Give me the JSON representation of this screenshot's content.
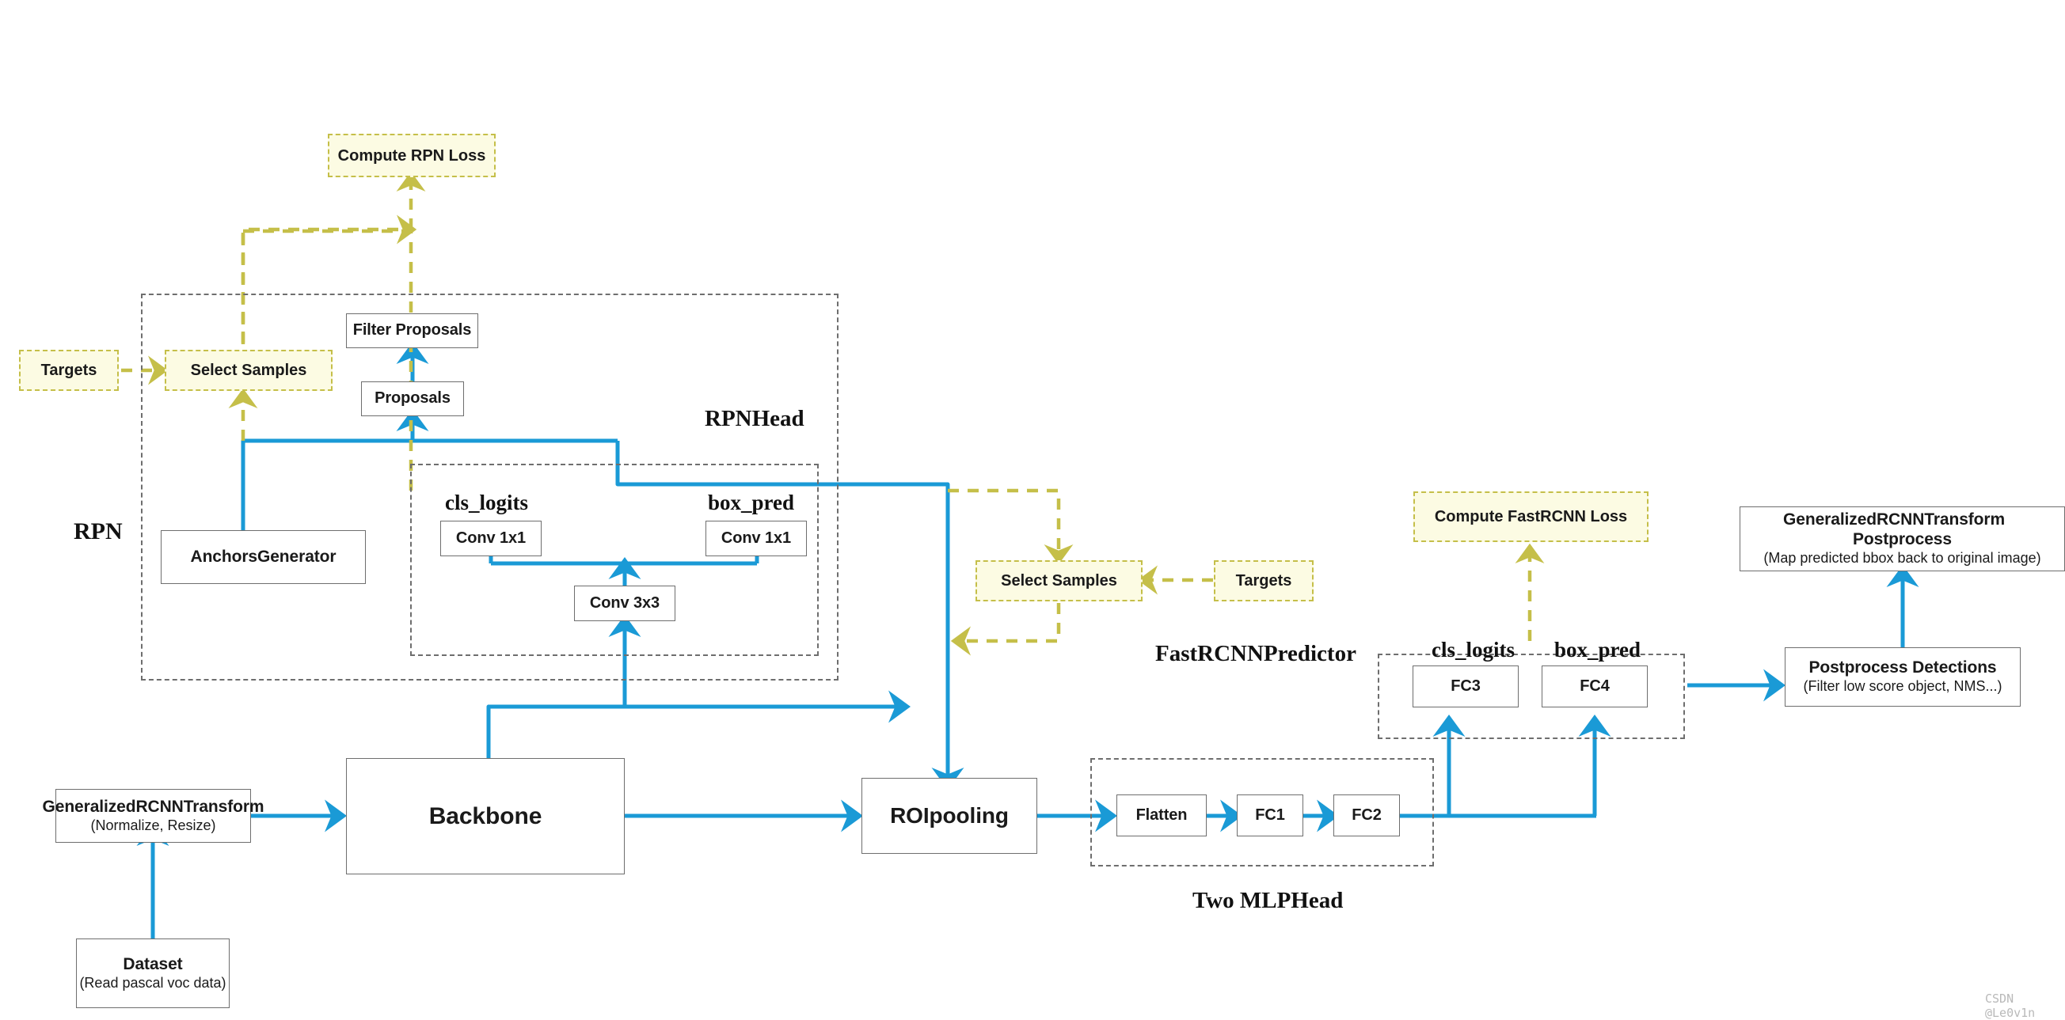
{
  "diagram": {
    "title": "Faster R-CNN training / inference pipeline",
    "colors": {
      "flow_blue": "#1a9ad6",
      "loss_yellow": "#c5bf49",
      "loss_fill": "#fcfbe3",
      "group_gray": "#6e6e6e",
      "box_border": "#6e6e6e",
      "text": "#1a1a1a"
    },
    "captions": {
      "rpn": "RPN",
      "rpn_head": "RPNHead",
      "rpn_cls_logits": "cls_logits",
      "rpn_box_pred": "box_pred",
      "fastrcnn_predictor": "FastRCNNPredictor",
      "predictor_cls_logits": "cls_logits",
      "predictor_box_pred": "box_pred",
      "two_mlp_head": "Two MLPHead"
    },
    "nodes": {
      "dataset": {
        "line1": "Dataset",
        "line2": "(Read pascal voc data)"
      },
      "transform": {
        "line1": "GeneralizedRCNNTransform",
        "line2": "(Normalize, Resize)"
      },
      "backbone": {
        "line1": "Backbone"
      },
      "anchors_generator": {
        "line1": "AnchorsGenerator"
      },
      "conv3x3": {
        "line1": "Conv 3x3"
      },
      "conv1x1_cls": {
        "line1": "Conv 1x1"
      },
      "conv1x1_box": {
        "line1": "Conv 1x1"
      },
      "proposals": {
        "line1": "Proposals"
      },
      "filter_proposals": {
        "line1": "Filter Proposals"
      },
      "roipooling": {
        "line1": "ROIpooling"
      },
      "flatten": {
        "line1": "Flatten"
      },
      "fc1": {
        "line1": "FC1"
      },
      "fc2": {
        "line1": "FC2"
      },
      "fc3": {
        "line1": "FC3"
      },
      "fc4": {
        "line1": "FC4"
      },
      "postprocess_detections": {
        "line1": "Postprocess Detections",
        "line2": "(Filter low score object,  NMS...)"
      },
      "transform_postprocess": {
        "line1": "GeneralizedRCNNTransform Postprocess",
        "line2": "(Map predicted bbox back to original image)"
      }
    },
    "loss_nodes": {
      "compute_rpn_loss": {
        "label": "Compute RPN Loss"
      },
      "rpn_targets": {
        "label": "Targets"
      },
      "rpn_select_samples": {
        "label": "Select Samples"
      },
      "fastrcnn_targets": {
        "label": "Targets"
      },
      "fastrcnn_select_samples": {
        "label": "Select Samples"
      },
      "compute_fastrcnn_loss": {
        "label": "Compute FastRCNN Loss"
      }
    },
    "watermark": "CSDN @Le0v1n"
  }
}
